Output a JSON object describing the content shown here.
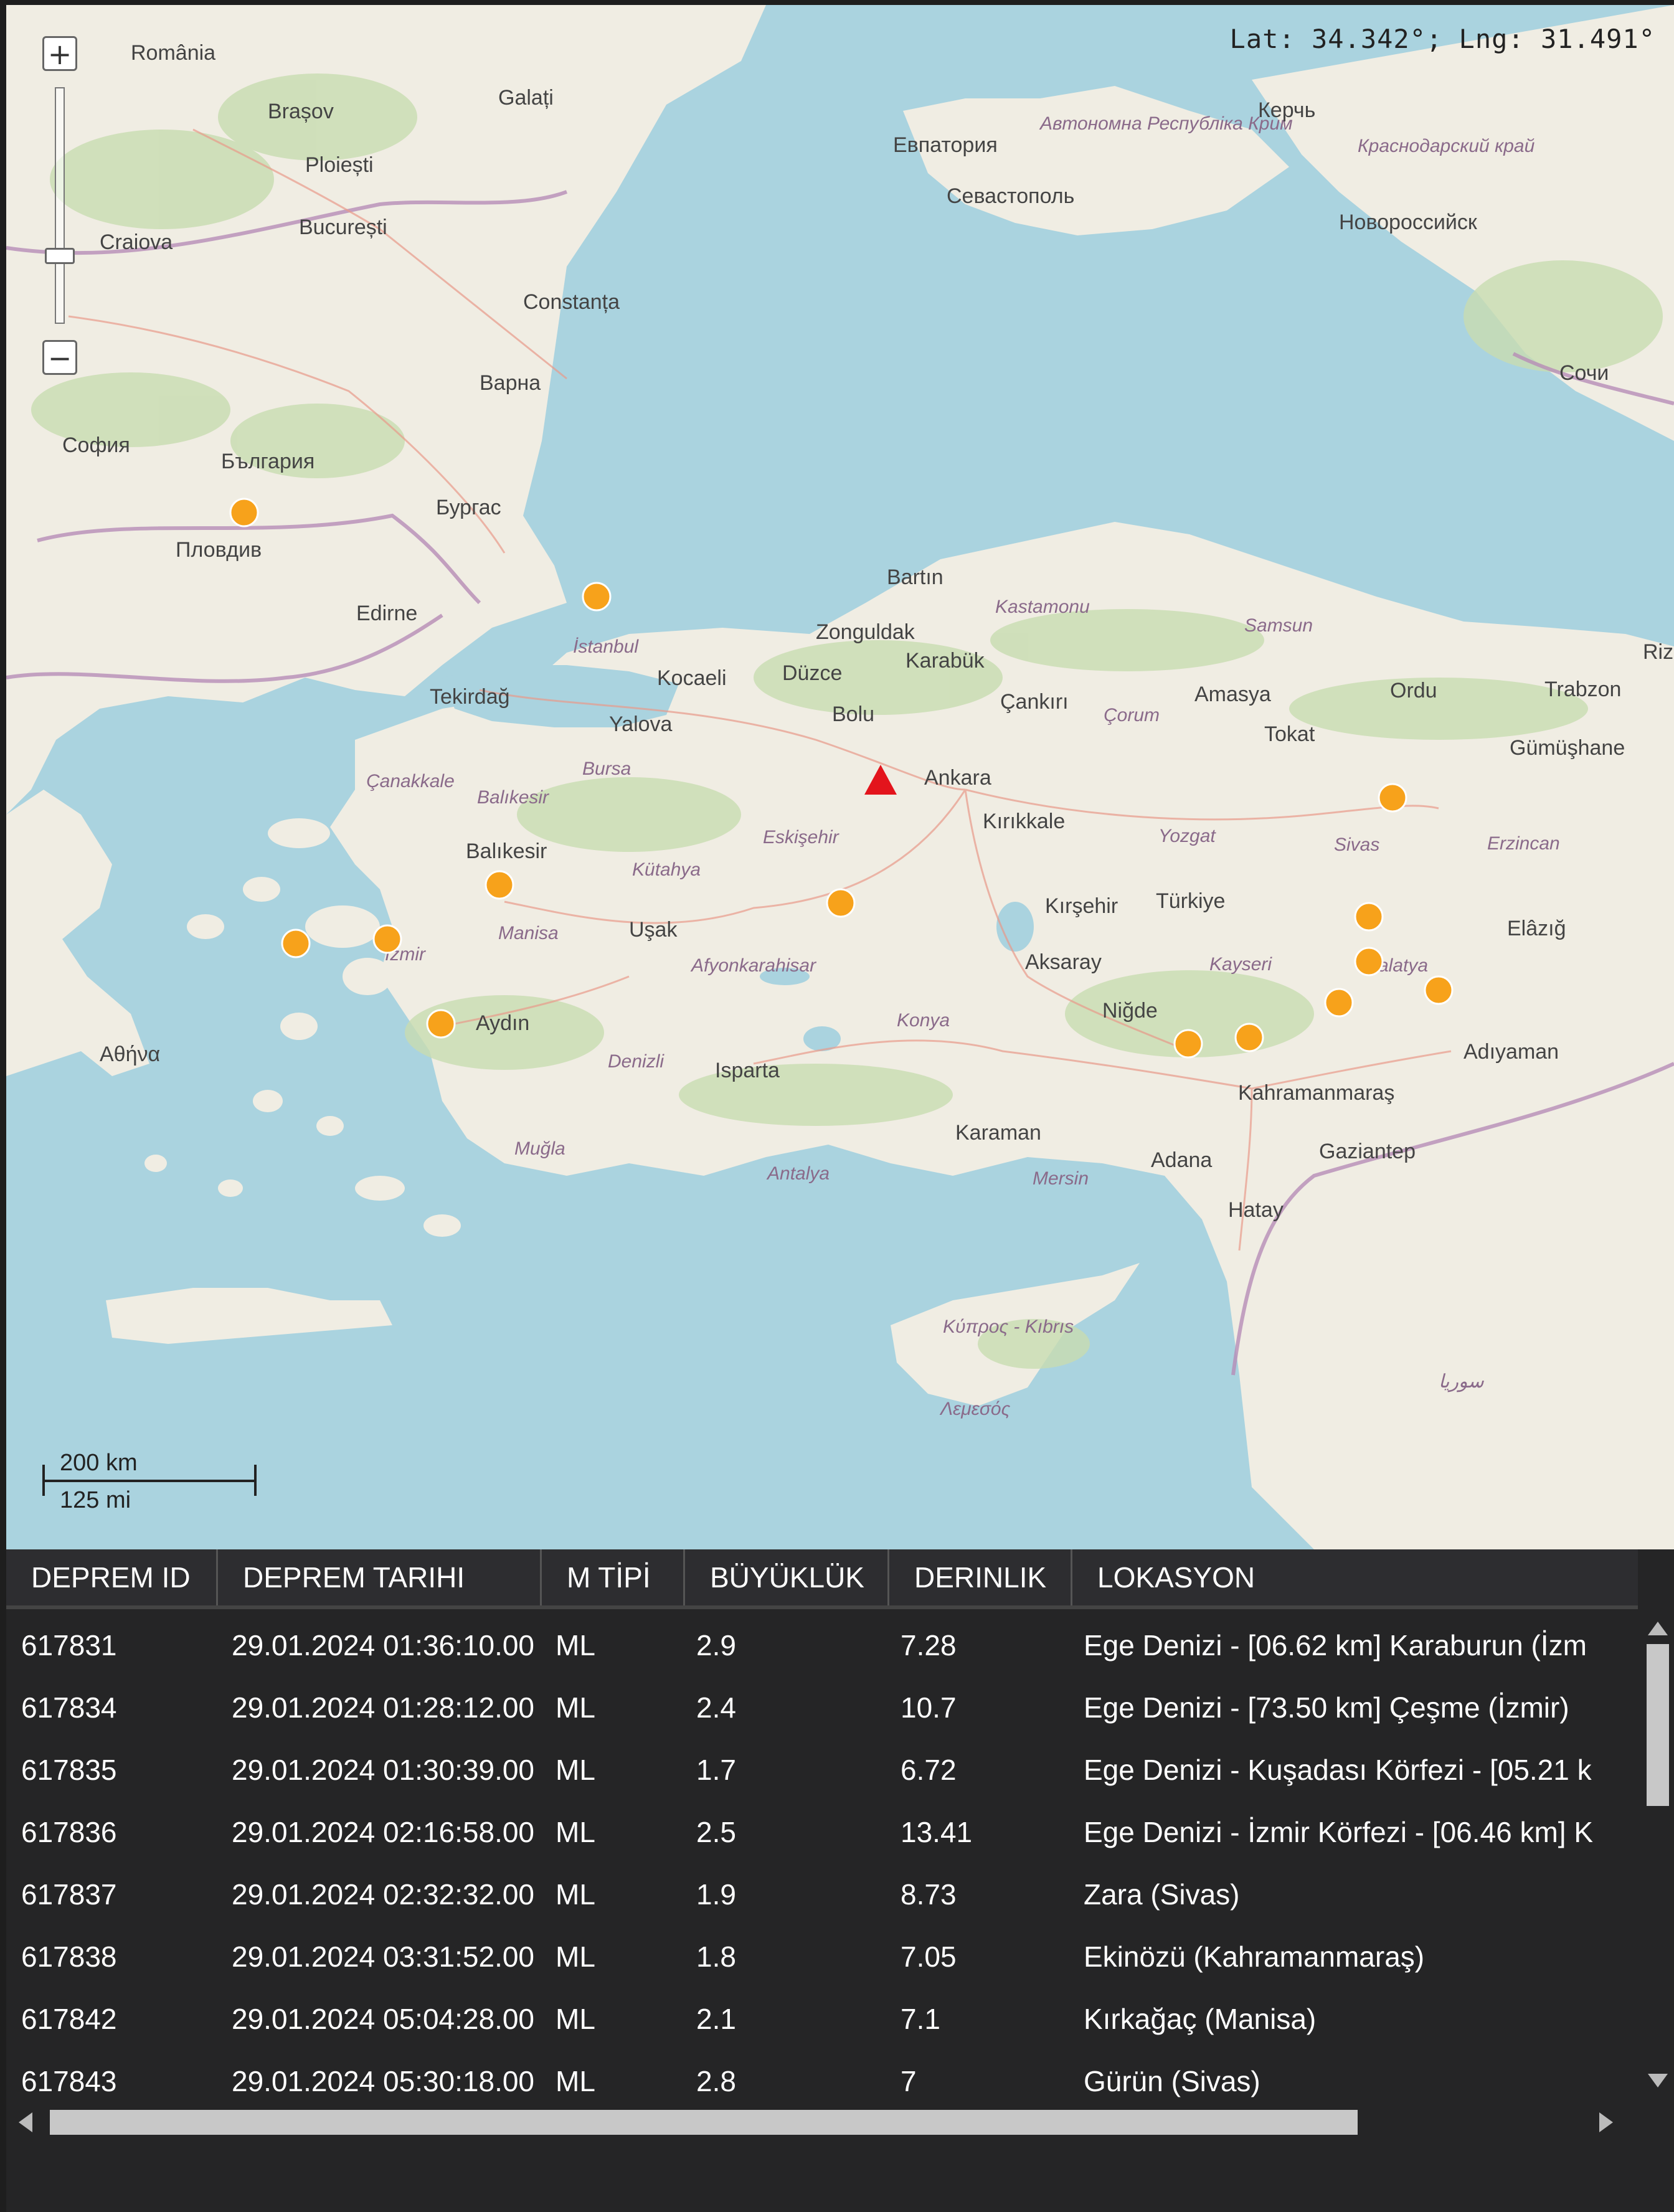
{
  "map": {
    "coordinate_readout": "Lat: 34.342°; Lng: 31.491°",
    "zoom_in": "+",
    "zoom_out": "−",
    "scale_km": "200 km",
    "scale_mi": "125 mi",
    "labels": {
      "romania": "România",
      "bulgaria": "България",
      "turkiye": "Türkiye",
      "sofia": "София",
      "plovdiv": "Пловдив",
      "burgas": "Бургас",
      "varna": "Варна",
      "bucuresti": "București",
      "constanta": "Constanța",
      "craiova": "Craiova",
      "ploiesti": "Ploiești",
      "brasov": "Brașov",
      "galati": "Galați",
      "sevastopol": "Севастополь",
      "evpatoria": "Евпатория",
      "kerch": "Керчь",
      "novorossiysk": "Новороссийск",
      "sochi": "Сочи",
      "krym": "Автономна Республіка Крим",
      "krasnodar": "Краснодарский край",
      "edirne": "Edirne",
      "istanbul": "İstanbul",
      "tekirdag": "Tekirdağ",
      "kocaeli": "Kocaeli",
      "yalova": "Yalova",
      "bursa": "Bursa",
      "balikesir": "Balıkesir",
      "canakkale": "Çanakkale",
      "izmir": "İzmir",
      "manisa": "Manisa",
      "aydin": "Aydın",
      "mugla": "Muğla",
      "denizli": "Denizli",
      "usak": "Uşak",
      "kutahya": "Kütahya",
      "afyon": "Afyonkarahisar",
      "eskisehir": "Eskişehir",
      "isparta": "Isparta",
      "antalya": "Antalya",
      "konya": "Konya",
      "karaman": "Karaman",
      "mersin": "Mersin",
      "adana": "Adana",
      "hatay": "Hatay",
      "gaziantep": "Gaziantep",
      "kahramanmaras": "Kahramanmaraş",
      "adiyaman": "Adıyaman",
      "malatya": "Malatya",
      "elazig": "Elâzığ",
      "sivas": "Sivas",
      "tokat": "Tokat",
      "ordu": "Ordu",
      "trabzon": "Trabzon",
      "samsun": "Samsun",
      "amasya": "Amasya",
      "corum": "Çorum",
      "yozgat": "Yozgat",
      "kayseri": "Kayseri",
      "nigde": "Niğde",
      "aksaray": "Aksaray",
      "kirsehir": "Kırşehir",
      "kirikkale": "Kırıkkale",
      "ankara": "Ankara",
      "cankiri": "Çankırı",
      "kastamonu": "Kastamonu",
      "bartin": "Bartın",
      "zonguldak": "Zonguldak",
      "karabuk": "Karabük",
      "duzce": "Düzce",
      "bolu": "Bolu",
      "erzincan": "Erzincan",
      "gumushane": "Gümüşhane",
      "rize": "Rize",
      "athina": "Αθήνα",
      "kypros": "Κύπρος - Kıbrıs",
      "lemesos": "Λεμεσός",
      "suriye": "سوريا"
    },
    "colors": {
      "sea": "#aad3df",
      "land": "#f2efe9",
      "forest": "#c8dcb4",
      "marker": "#f7a21b",
      "station": "#e3141c"
    }
  },
  "table": {
    "columns": [
      "DEPREM ID",
      "DEPREM TARIHI",
      "M TİPİ",
      "BÜYÜKLÜK",
      "DERINLIK",
      "LOKASYON"
    ],
    "rows": [
      [
        "617831",
        "29.01.2024 01:36:10.00",
        "ML",
        "2.9",
        "7.28",
        "Ege Denizi - [06.62 km] Karaburun (İzm"
      ],
      [
        "617834",
        "29.01.2024 01:28:12.00",
        "ML",
        "2.4",
        "10.7",
        "Ege Denizi - [73.50 km] Çeşme (İzmir)"
      ],
      [
        "617835",
        "29.01.2024 01:30:39.00",
        "ML",
        "1.7",
        "6.72",
        "Ege Denizi - Kuşadası Körfezi - [05.21 k"
      ],
      [
        "617836",
        "29.01.2024 02:16:58.00",
        "ML",
        "2.5",
        "13.41",
        "Ege Denizi - İzmir Körfezi - [06.46 km] K"
      ],
      [
        "617837",
        "29.01.2024 02:32:32.00",
        "ML",
        "1.9",
        "8.73",
        "Zara (Sivas)"
      ],
      [
        "617838",
        "29.01.2024 03:31:52.00",
        "ML",
        "1.8",
        "7.05",
        "Ekinözü (Kahramanmaraş)"
      ],
      [
        "617842",
        "29.01.2024 05:04:28.00",
        "ML",
        "2.1",
        "7.1",
        "Kırkağaç (Manisa)"
      ],
      [
        "617843",
        "29.01.2024 05:30:18.00",
        "ML",
        "2.8",
        "7",
        "Gürün (Sivas)"
      ]
    ]
  }
}
